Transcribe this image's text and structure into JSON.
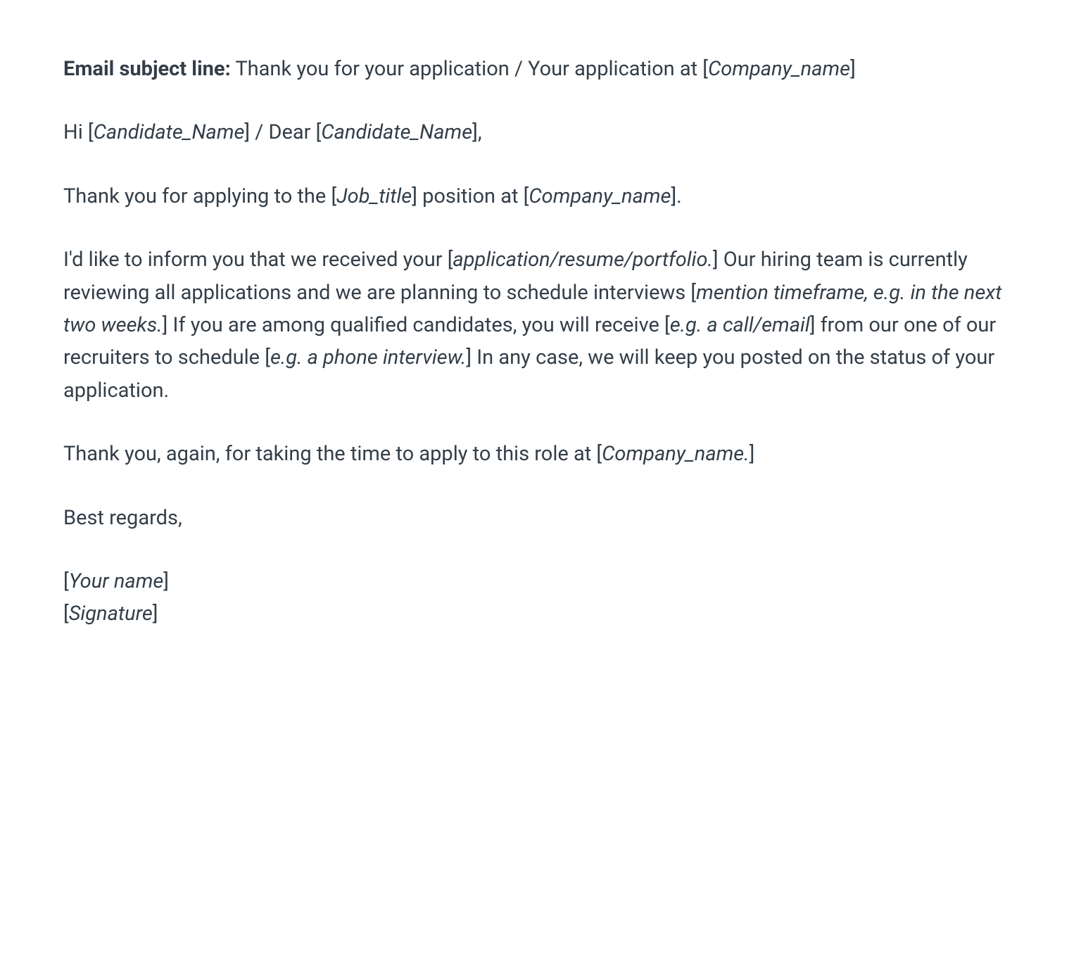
{
  "subject": {
    "label": "Email subject line:",
    "text1": " Thank you for your application / Your application at [",
    "placeholder1": "Company_name",
    "text2": "]"
  },
  "greeting": {
    "text1": "Hi [",
    "placeholder1": "Candidate_Name",
    "text2": "] / Dear [",
    "placeholder2": "Candidate_Name",
    "text3": "],"
  },
  "para1": {
    "text1": "Thank you for applying to the [",
    "placeholder1": "Job_title",
    "text2": "] position at [",
    "placeholder2": "Company_name",
    "text3": "]."
  },
  "para2": {
    "text1": "I'd like to inform you that we received your [",
    "placeholder1": "application/resume/portfolio.",
    "text2": "] Our hiring team is currently reviewing all applications and we are planning to schedule interviews [",
    "placeholder2": "mention timeframe, e.g. in the next two weeks.",
    "text3": "] If you are among qualified candidates, you will receive [",
    "placeholder3": "e.g. a call/email",
    "text4": "] from our one of our recruiters to schedule [",
    "placeholder4": "e.g. a phone interview.",
    "text5": "] In any case, we will keep you posted on the status of your application."
  },
  "para3": {
    "text1": "Thank you, again, for taking the time to apply to this role at [",
    "placeholder1": "Company_name.",
    "text2": "]"
  },
  "closing": {
    "text": "Best regards,"
  },
  "signature": {
    "text1": "[",
    "placeholder1": "Your name",
    "text2": "]",
    "text3": "[",
    "placeholder2": "Signature",
    "text4": "]"
  }
}
